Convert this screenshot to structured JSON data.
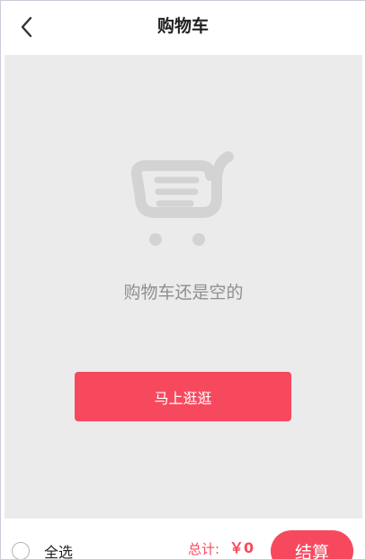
{
  "header": {
    "title": "购物车",
    "back_icon": "chevron-left-icon"
  },
  "empty_state": {
    "icon": "shopping-cart-icon",
    "message": "购物车还是空的",
    "action_label": "马上逛逛"
  },
  "footer": {
    "select_all_label": "全选",
    "total_label": "总计:",
    "total_value": "￥0",
    "checkout_label": "结算"
  },
  "colors": {
    "accent": "#f7495e",
    "content_background": "#ebebeb",
    "empty_icon": "#d3d3d3",
    "empty_text": "#8f8f8f"
  }
}
